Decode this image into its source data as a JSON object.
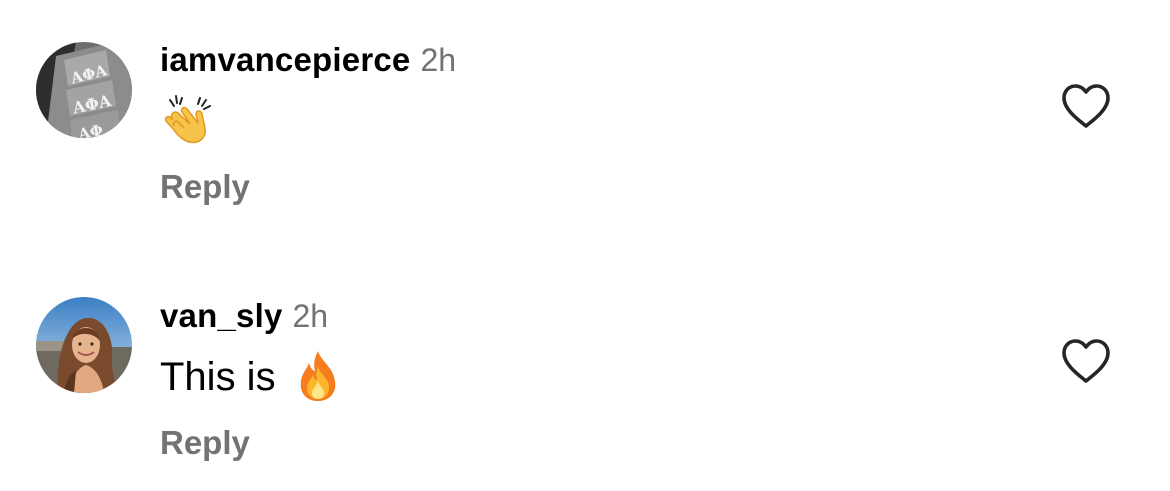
{
  "comments": [
    {
      "username": "iamvancepierce",
      "time": "2h",
      "text": "",
      "emoji": "clapping-hands",
      "reply_label": "Reply",
      "avatar": "greek-letters-photo"
    },
    {
      "username": "van_sly",
      "time": "2h",
      "text": "This is",
      "emoji": "fire",
      "reply_label": "Reply",
      "avatar": "woman-portrait-photo"
    }
  ],
  "icons": {
    "like": "heart-outline-icon"
  },
  "colors": {
    "text": "#000000",
    "secondary": "#737373",
    "background": "#ffffff"
  }
}
